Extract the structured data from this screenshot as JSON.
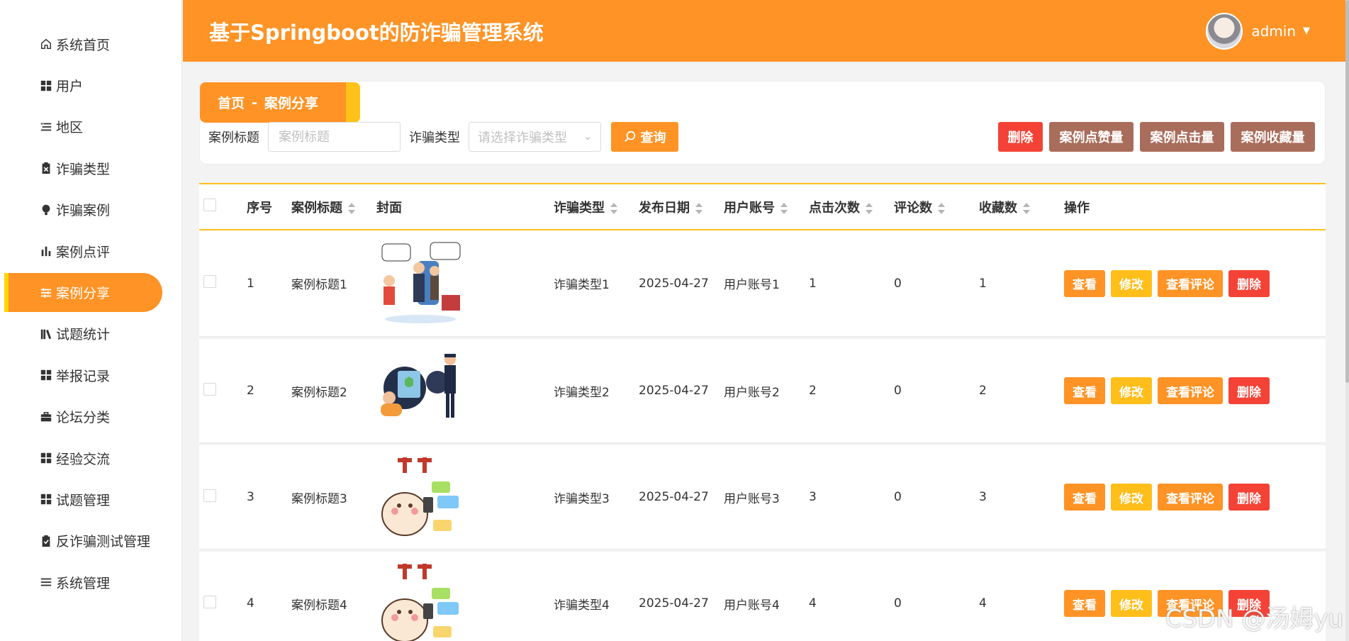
{
  "header": {
    "title": "基于Springboot的防诈骗管理系统",
    "username": "admin"
  },
  "sidebar": {
    "items": [
      {
        "label": "系统首页",
        "icon": "home-icon"
      },
      {
        "label": "用户",
        "icon": "grid-icon"
      },
      {
        "label": "地区",
        "icon": "list-icon"
      },
      {
        "label": "诈骗类型",
        "icon": "clipboard-x-icon"
      },
      {
        "label": "诈骗案例",
        "icon": "bulb-icon"
      },
      {
        "label": "案例点评",
        "icon": "bar-chart-icon"
      },
      {
        "label": "案例分享",
        "icon": "sliders-icon",
        "active": true
      },
      {
        "label": "试题统计",
        "icon": "books-icon"
      },
      {
        "label": "举报记录",
        "icon": "grid-icon"
      },
      {
        "label": "论坛分类",
        "icon": "briefcase-icon"
      },
      {
        "label": "经验交流",
        "icon": "grid-icon"
      },
      {
        "label": "试题管理",
        "icon": "grid-icon"
      },
      {
        "label": "反诈骗测试管理",
        "icon": "clipboard-check-icon"
      },
      {
        "label": "系统管理",
        "icon": "menu-icon"
      }
    ]
  },
  "breadcrumb": {
    "home": "首页",
    "separator": "-",
    "current": "案例分享"
  },
  "search": {
    "title_label": "案例标题",
    "title_placeholder": "案例标题",
    "type_label": "诈骗类型",
    "type_placeholder": "请选择诈骗类型",
    "query_button": "查询"
  },
  "toolbar": {
    "delete": "删除",
    "likes": "案例点赞量",
    "clicks": "案例点击量",
    "favorites": "案例收藏量"
  },
  "table": {
    "headers": {
      "no": "序号",
      "title": "案例标题",
      "cover": "封面",
      "type": "诈骗类型",
      "date": "发布日期",
      "user": "用户账号",
      "clicks": "点击次数",
      "comments": "评论数",
      "favs": "收藏数",
      "ops": "操作"
    },
    "rows": [
      {
        "no": "1",
        "title": "案例标题1",
        "type": "诈骗类型1",
        "date": "2025-04-27",
        "user": "用户账号1",
        "clicks": "1",
        "comments": "0",
        "favs": "1",
        "cover": "cartoon-scam-people"
      },
      {
        "no": "2",
        "title": "案例标题2",
        "type": "诈骗类型2",
        "date": "2025-04-27",
        "user": "用户账号2",
        "clicks": "2",
        "comments": "0",
        "favs": "2",
        "cover": "police-officer-shield"
      },
      {
        "no": "3",
        "title": "案例标题3",
        "type": "诈骗类型3",
        "date": "2025-04-27",
        "user": "用户账号3",
        "clicks": "3",
        "comments": "0",
        "favs": "3",
        "cover": "alert-bunny-sticker"
      },
      {
        "no": "4",
        "title": "案例标题4",
        "type": "诈骗类型4",
        "date": "2025-04-27",
        "user": "用户账号4",
        "clicks": "4",
        "comments": "0",
        "favs": "4",
        "cover": "alert-bunny-sticker"
      }
    ],
    "row_actions": {
      "view": "查看",
      "edit": "修改",
      "comments": "查看评论",
      "delete": "删除"
    }
  },
  "watermark": "CSDN @汤姆yu",
  "colors": {
    "primary": "#ff9325",
    "accent": "#ffbe1a",
    "danger": "#f44336",
    "brown": "#a96d5b"
  }
}
